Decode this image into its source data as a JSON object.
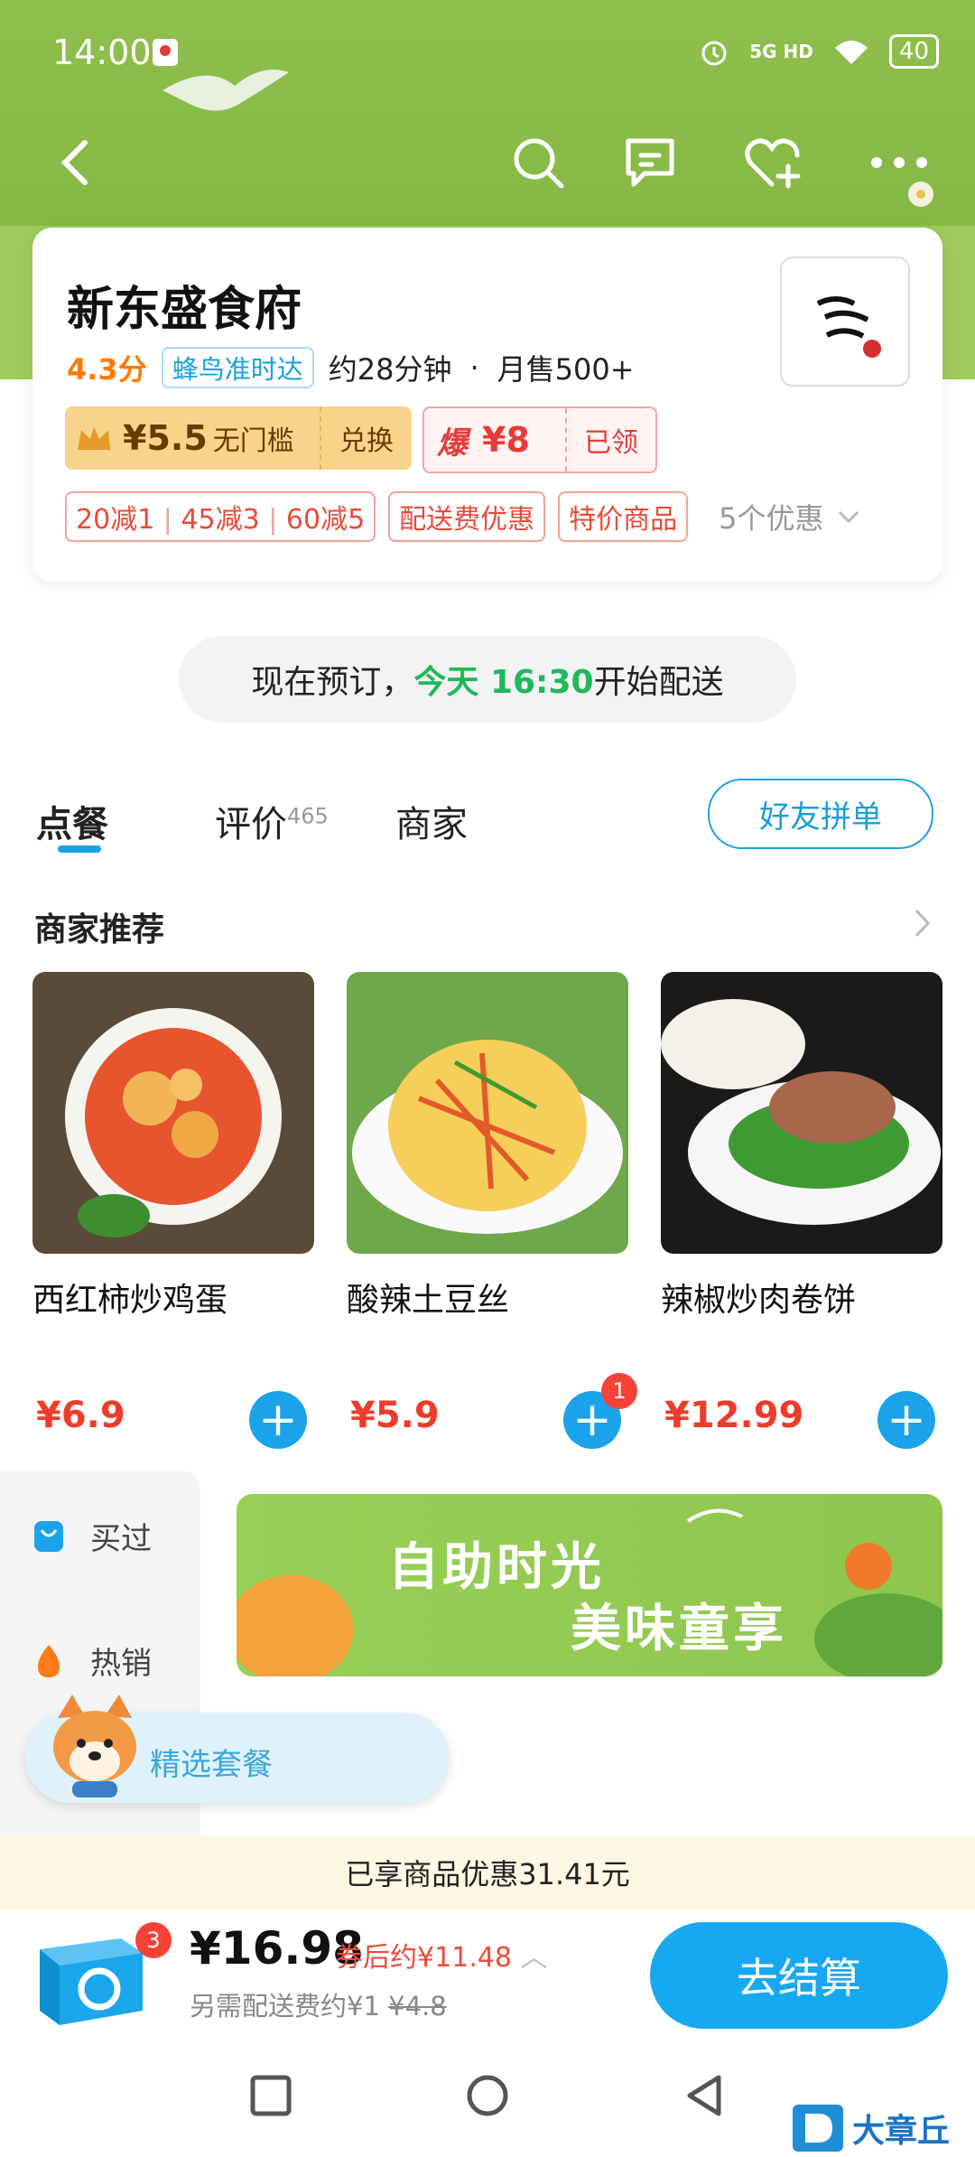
{
  "status": {
    "time": "14:00",
    "network": "5G HD",
    "battery": "40"
  },
  "shop": {
    "name": "新东盛食府",
    "rating": "4.3分",
    "delivery_tag": "蜂鸟准时达",
    "eta": "约28分钟",
    "sales": "月售500+",
    "coupon1": {
      "amount": "¥5.5",
      "condition": "无门槛",
      "action": "兑换"
    },
    "coupon2": {
      "prefix": "爆",
      "amount": "¥8",
      "action": "已领"
    },
    "promos": [
      "20减1",
      "45减3",
      "60减5",
      "配送费优惠",
      "特价商品"
    ],
    "promo_more": "5个优惠"
  },
  "presale": {
    "prefix": "现在预订，",
    "highlight": "今天 16:30",
    "suffix": " 开始配送"
  },
  "tabs": [
    {
      "label": "点餐"
    },
    {
      "label": "评价",
      "count": "465"
    },
    {
      "label": "商家"
    }
  ],
  "friend_order": "好友拼单",
  "recommend": {
    "title": "商家推荐",
    "items": [
      {
        "name": "西红柿炒鸡蛋",
        "price": "¥6.9"
      },
      {
        "name": "酸辣土豆丝",
        "price": "¥5.9",
        "cart_count": "1"
      },
      {
        "name": "辣椒炒肉卷饼",
        "price": "¥12.99"
      }
    ]
  },
  "sidebar": {
    "items": [
      {
        "label": "买过"
      },
      {
        "label": "热销"
      }
    ]
  },
  "banner": {
    "line1": "自助时光",
    "line2": "美味童享"
  },
  "combo_pill": "精选套餐",
  "discount_notice": "已享商品优惠31.41元",
  "cart": {
    "count": "3",
    "total": "¥16.98",
    "after_coupon": "券后约¥11.48",
    "delivery_fee": "另需配送费约¥1",
    "original_fee": "¥4.8",
    "checkout": "去结算"
  },
  "watermark": "大章丘",
  "colors": {
    "accent": "#16a8f0",
    "price": "#ef3b2a",
    "green": "#1fb85a",
    "header": "#8fbf4d"
  }
}
